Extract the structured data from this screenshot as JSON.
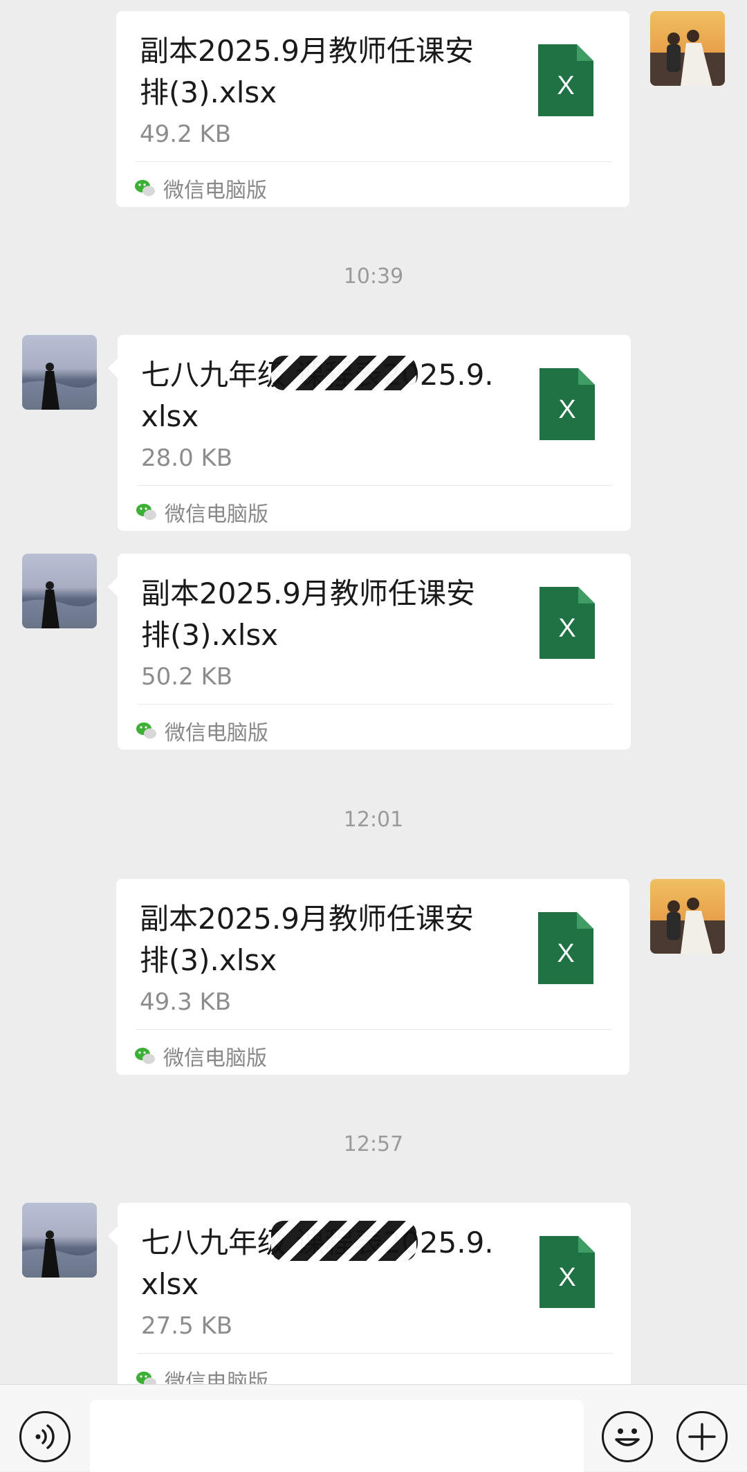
{
  "chat": {
    "timestamps": [
      "10:39",
      "12:01",
      "12:57"
    ],
    "messages": [
      {
        "sender": "self",
        "file_name": "副本2025.9月教师任课安排(3).xlsx",
        "file_size": "49.2 KB",
        "source": "微信电脑版",
        "file_icon": "excel-icon"
      },
      {
        "sender": "contact",
        "file_name": "七八九年级  课程表2025.9.xlsx",
        "file_size": "28.0 KB",
        "source": "微信电脑版",
        "file_icon": "excel-icon"
      },
      {
        "sender": "contact",
        "file_name": "副本2025.9月教师任课安排(3).xlsx",
        "file_size": "50.2 KB",
        "source": "微信电脑版",
        "file_icon": "excel-icon"
      },
      {
        "sender": "self",
        "file_name": "副本2025.9月教师任课安排(3).xlsx",
        "file_size": "49.3 KB",
        "source": "微信电脑版",
        "file_icon": "excel-icon"
      },
      {
        "sender": "contact",
        "file_name": "七八九年级  课程表2025.9.xlsx",
        "file_size": "27.5 KB",
        "source": "微信电脑版",
        "file_icon": "excel-icon"
      }
    ],
    "excel_letter": "X"
  },
  "input_bar": {
    "voice_icon": "voice-icon",
    "message_placeholder": "",
    "emoji_icon": "emoji-icon",
    "plus_icon": "plus-icon"
  },
  "colors": {
    "background": "#ededed",
    "bubble": "#ffffff",
    "excel_green": "#1f7244",
    "excel_fold": "#3f9c64",
    "timestamp": "#9a9a9a"
  }
}
